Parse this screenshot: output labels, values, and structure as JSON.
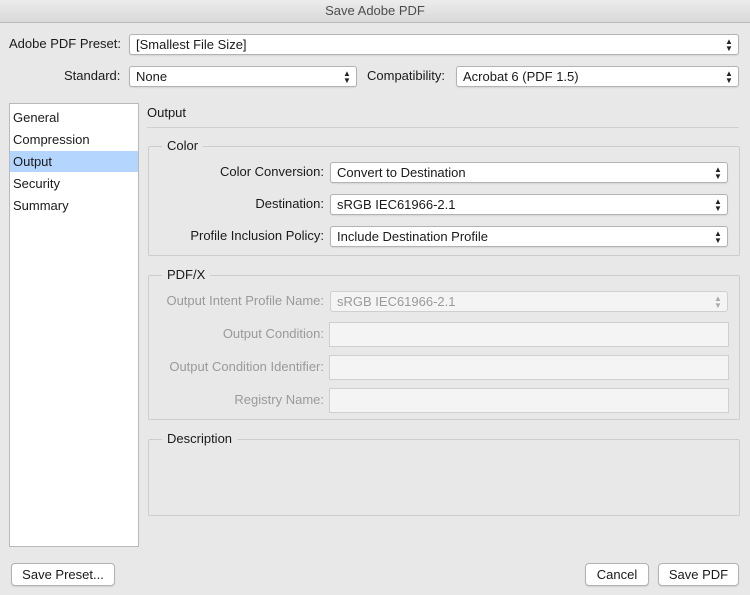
{
  "window": {
    "title": "Save Adobe PDF"
  },
  "preset": {
    "label": "Adobe PDF Preset:",
    "value": "[Smallest File Size]"
  },
  "standard": {
    "label": "Standard:",
    "value": "None"
  },
  "compatibility": {
    "label": "Compatibility:",
    "value": "Acrobat 6 (PDF 1.5)"
  },
  "sidebar": {
    "items": [
      {
        "label": "General"
      },
      {
        "label": "Compression"
      },
      {
        "label": "Output"
      },
      {
        "label": "Security"
      },
      {
        "label": "Summary"
      }
    ],
    "selected": "Output"
  },
  "section": {
    "title": "Output"
  },
  "color_group": {
    "title": "Color",
    "conversion": {
      "label": "Color Conversion:",
      "value": "Convert to Destination"
    },
    "destination": {
      "label": "Destination:",
      "value": "sRGB IEC61966-2.1"
    },
    "policy": {
      "label": "Profile Inclusion Policy:",
      "value": "Include Destination Profile"
    }
  },
  "pdfx_group": {
    "title": "PDF/X",
    "intent": {
      "label": "Output Intent Profile Name:",
      "value": "sRGB IEC61966-2.1"
    },
    "condition": {
      "label": "Output Condition:",
      "value": ""
    },
    "condition_id": {
      "label": "Output Condition Identifier:",
      "value": ""
    },
    "registry": {
      "label": "Registry Name:",
      "value": ""
    }
  },
  "description_group": {
    "title": "Description"
  },
  "buttons": {
    "save_preset": "Save Preset...",
    "cancel": "Cancel",
    "save_pdf": "Save PDF"
  }
}
